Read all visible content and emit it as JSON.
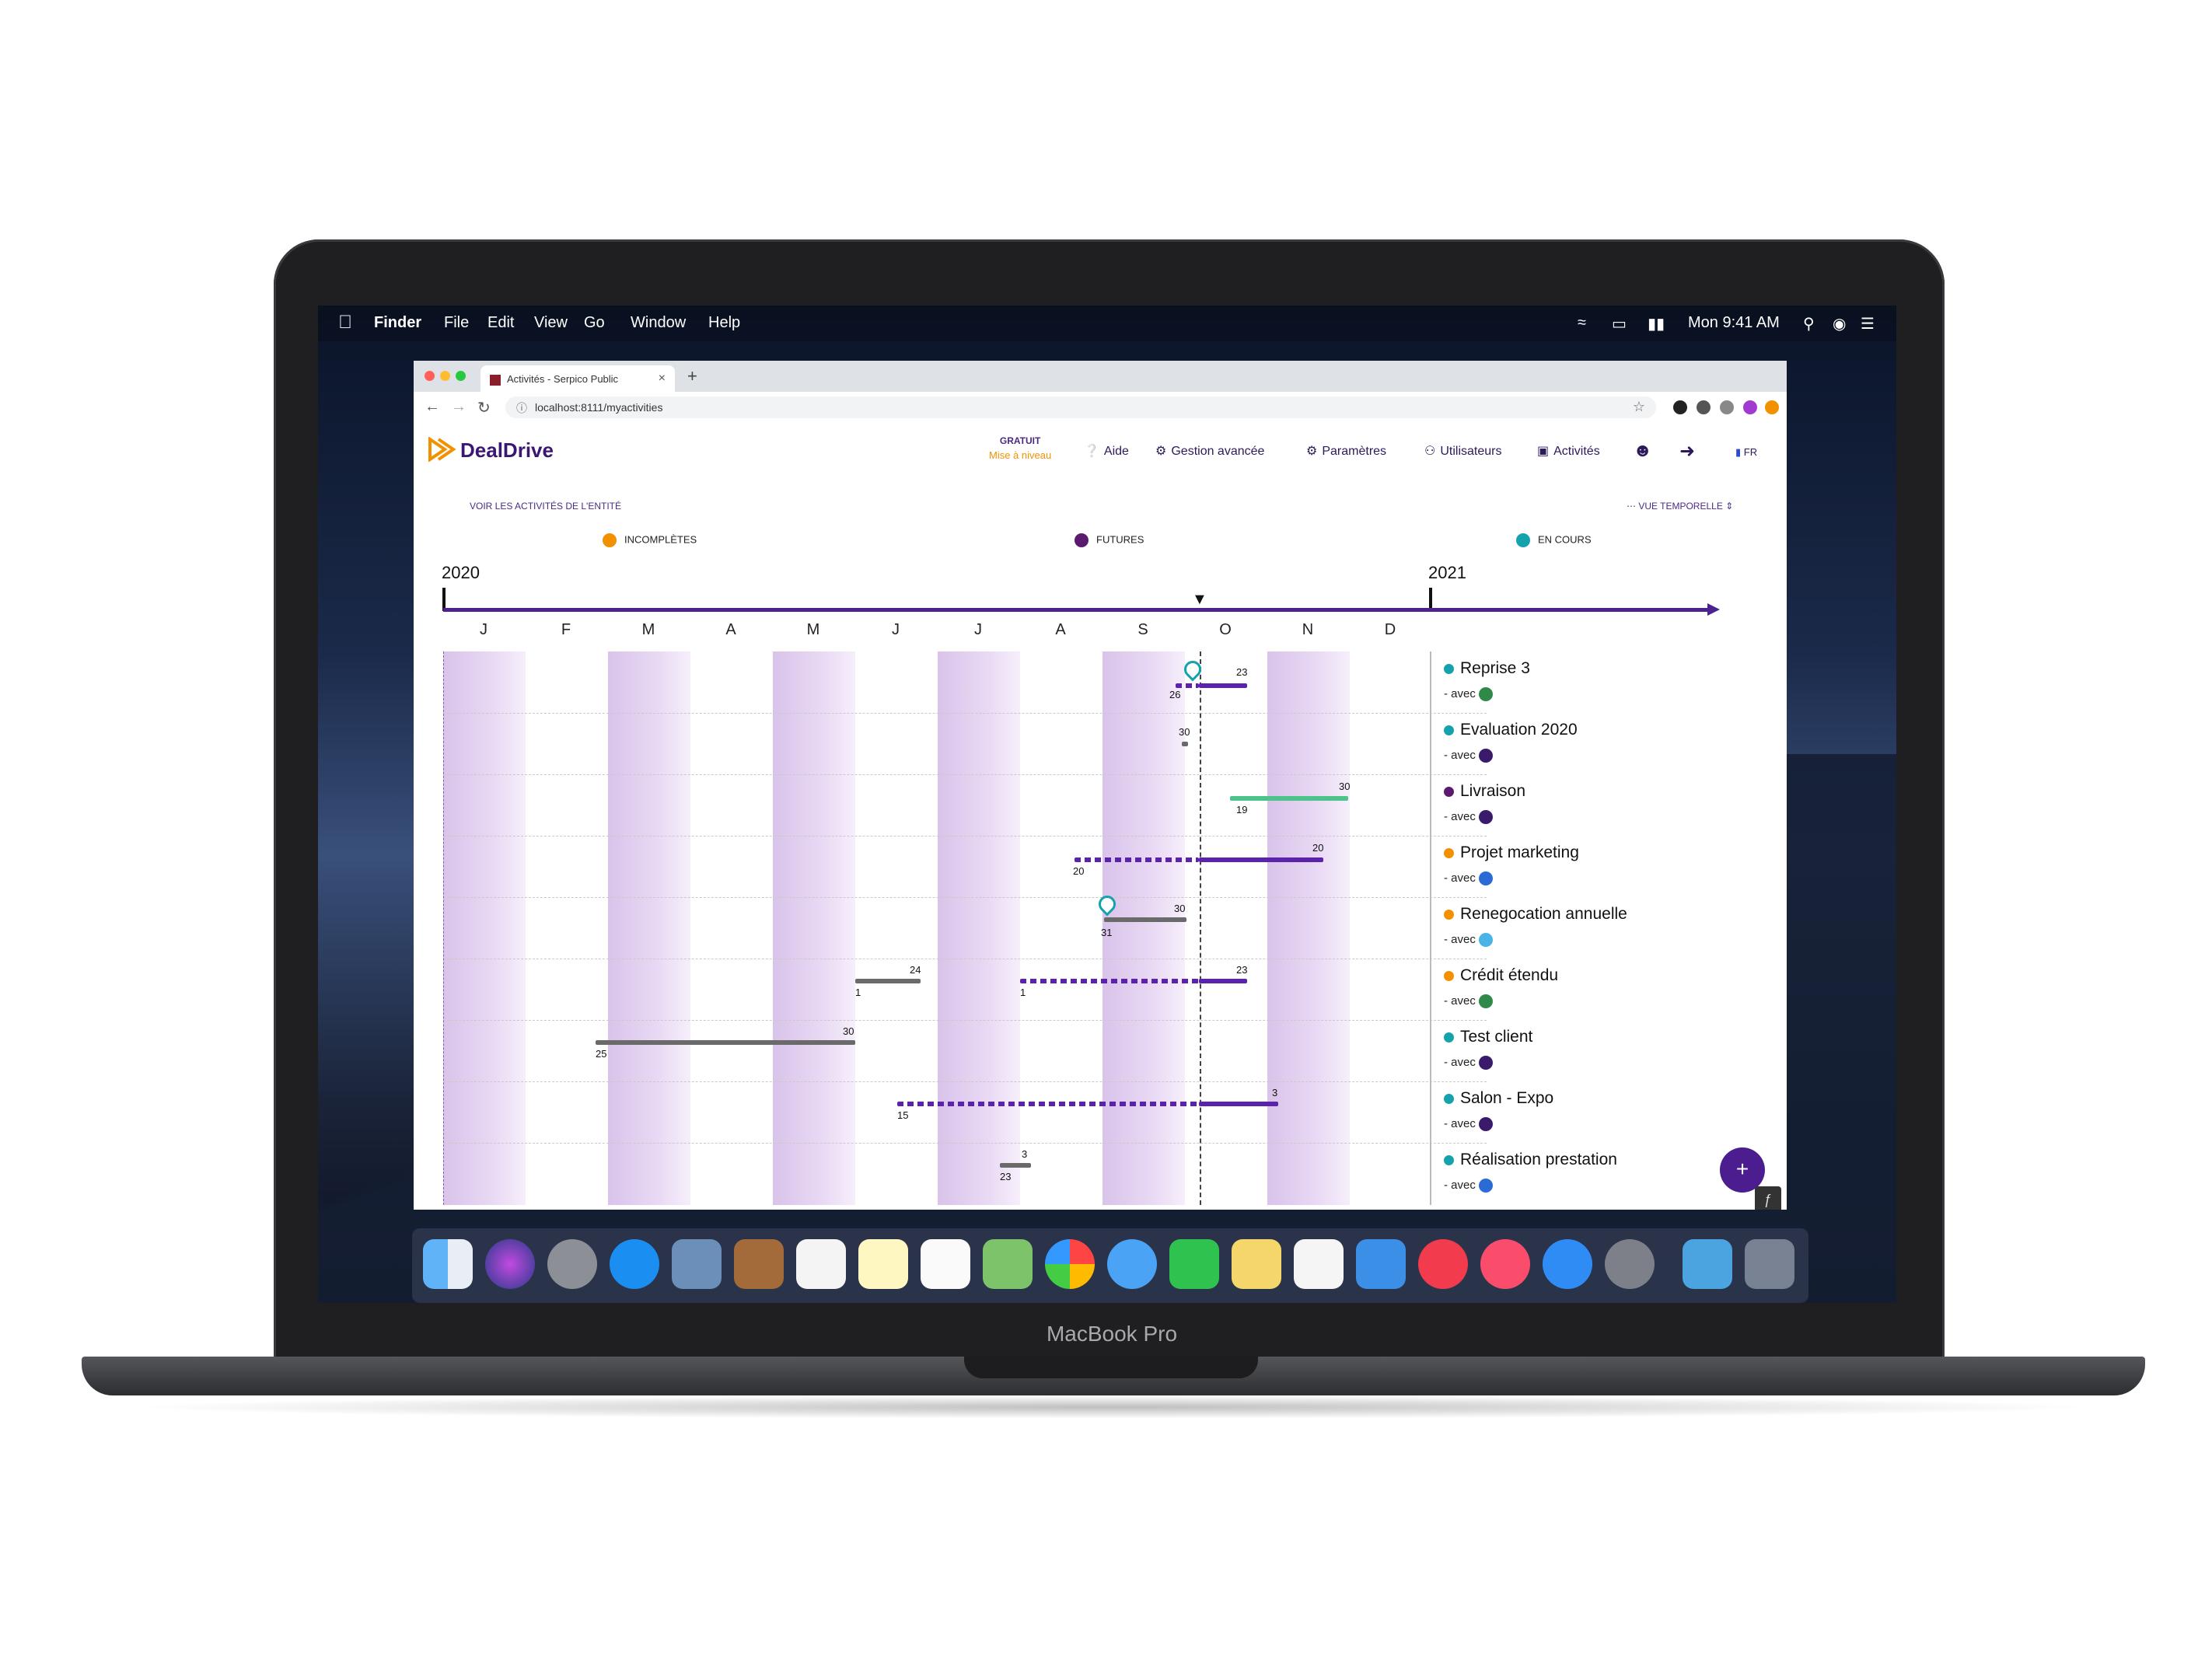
{
  "menubar": {
    "app": "Finder",
    "items": [
      "File",
      "Edit",
      "View",
      "Go",
      "Window",
      "Help"
    ],
    "clock": "Mon 9:41 AM"
  },
  "browser": {
    "tab_title": "Activités - Serpico Public",
    "url": "localhost:8111/myactivities"
  },
  "app": {
    "brand": "DealDrive",
    "plan": {
      "label": "GRATUIT",
      "upgrade": "Mise à niveau"
    },
    "nav": [
      {
        "label": "Aide",
        "icon": "help-icon"
      },
      {
        "label": "Gestion avancée",
        "icon": "gears-icon"
      },
      {
        "label": "Paramètres",
        "icon": "gear-icon"
      },
      {
        "label": "Utilisateurs",
        "icon": "users-icon"
      },
      {
        "label": "Activités",
        "icon": "briefcase-icon"
      }
    ],
    "lang": "FR",
    "entity_link": "VOIR LES ACTIVITÉS DE L'ENTITÉ",
    "view_toggle": "VUE TEMPORELLE",
    "legend": [
      {
        "label": "INCOMPLÈTES",
        "color": "#f29100"
      },
      {
        "label": "FUTURES",
        "color": "#5c1a6e"
      },
      {
        "label": "EN COURS",
        "color": "#16a2ad"
      }
    ],
    "years": [
      "2020",
      "2021"
    ],
    "months": [
      "J",
      "F",
      "M",
      "A",
      "M",
      "J",
      "J",
      "A",
      "S",
      "O",
      "N",
      "D"
    ],
    "activities": [
      {
        "name": "Reprise 3",
        "with": "- avec",
        "status_color": "#16a2ad",
        "avatar_color": "#2f8a4a"
      },
      {
        "name": "Evaluation 2020",
        "with": "- avec",
        "status_color": "#16a2ad",
        "avatar_color": "#3a1a6a"
      },
      {
        "name": "Livraison",
        "with": "- avec",
        "status_color": "#5c1a6e",
        "avatar_color": "#3a1a6a"
      },
      {
        "name": "Projet marketing",
        "with": "- avec",
        "status_color": "#f29100",
        "avatar_color": "#2a6bd6"
      },
      {
        "name": "Renegocation annuelle",
        "with": "- avec",
        "status_color": "#f29100",
        "avatar_color": "#4ab3e8"
      },
      {
        "name": "Crédit étendu",
        "with": "- avec",
        "status_color": "#f29100",
        "avatar_color": "#2f8a4a"
      },
      {
        "name": "Test client",
        "with": "- avec",
        "status_color": "#16a2ad",
        "avatar_color": "#3a1a6a"
      },
      {
        "name": "Salon - Expo",
        "with": "- avec",
        "status_color": "#16a2ad",
        "avatar_color": "#3a1a6a"
      },
      {
        "name": "Réalisation prestation",
        "with": "- avec",
        "status_color": "#16a2ad",
        "avatar_color": "#2a6bd6"
      }
    ],
    "bar_labels": {
      "r0": [
        "23",
        "26"
      ],
      "r1": [
        "30"
      ],
      "r2": [
        "30",
        "19"
      ],
      "r3": [
        "20",
        "20"
      ],
      "r4": [
        "30",
        "31"
      ],
      "r5": [
        "24",
        "1",
        "23",
        "1"
      ],
      "r6": [
        "30",
        "25"
      ],
      "r7": [
        "3",
        "15"
      ],
      "r8": [
        "3",
        "23"
      ]
    },
    "fab": "+"
  },
  "laptop_label": "MacBook Pro"
}
